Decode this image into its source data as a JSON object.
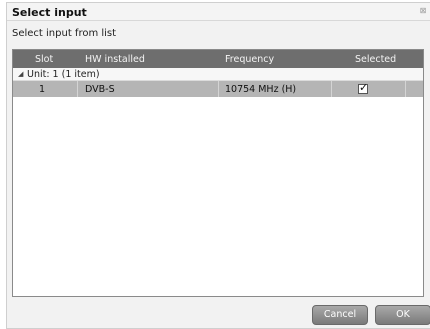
{
  "window": {
    "title": "Select input",
    "close_glyph": "⊠"
  },
  "subtitle": "Select input from list",
  "table": {
    "columns": [
      "Slot",
      "HW installed",
      "Frequency",
      "Selected"
    ],
    "group": {
      "label": "Unit: 1 (1 item)",
      "expand_glyph": "◢"
    },
    "rows": [
      {
        "slot": "1",
        "hw": "DVB-S",
        "frequency": "10754 MHz (H)",
        "selected": true
      }
    ]
  },
  "buttons": {
    "cancel": "Cancel",
    "ok": "OK"
  },
  "icons": {
    "close": "close-icon",
    "expand": "expand-collapse-icon",
    "check": "checkmark-icon"
  },
  "colors": {
    "header_bg": "#6e6e6e",
    "selected_row_bg": "#b5b5b5",
    "button_bg": "#8f8f8f"
  }
}
